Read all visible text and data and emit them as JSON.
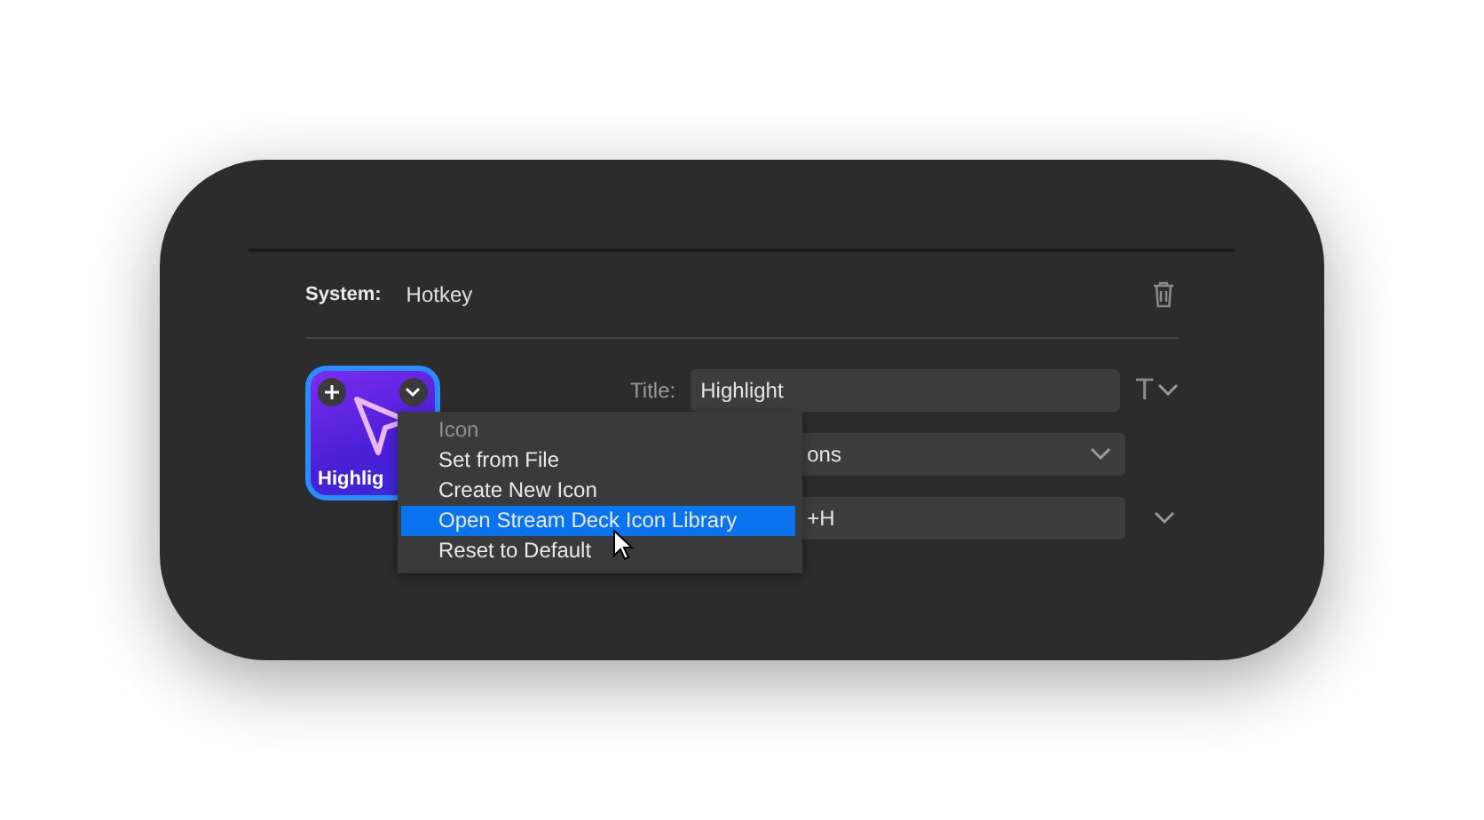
{
  "header": {
    "label": "System:",
    "value": "Hotkey"
  },
  "key_icon": {
    "caption": "Highlig"
  },
  "fields": [
    {
      "kind": "text",
      "label": "Title:",
      "value": "Highlight",
      "style_glyph": "T"
    },
    {
      "kind": "select",
      "value": "ons"
    },
    {
      "kind": "hotkey",
      "value": "+H"
    }
  ],
  "context_menu": {
    "heading": "Icon",
    "items": [
      {
        "label": "Set from File",
        "selected": false
      },
      {
        "label": "Create New Icon",
        "selected": false
      },
      {
        "label": "Open Stream Deck Icon Library",
        "selected": true
      },
      {
        "label": "Reset to Default",
        "selected": false
      }
    ]
  }
}
